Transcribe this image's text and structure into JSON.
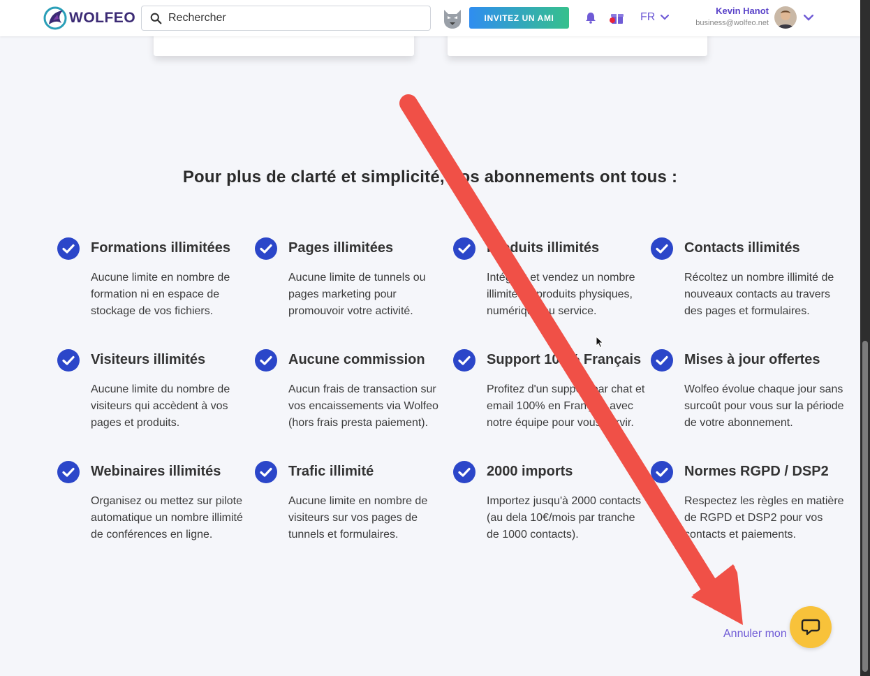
{
  "header": {
    "brand": "WOLFEO",
    "search_placeholder": "Rechercher",
    "invite_label": "INVITEZ UN AMI",
    "language": "FR",
    "user_name": "Kevin Hanot",
    "user_email": "business@wolfeo.net"
  },
  "colors": {
    "accent": "#6f5bd6",
    "check": "#2b46c9",
    "chat": "#f8c23a",
    "arrow": "#f05047"
  },
  "section": {
    "title": "Pour plus de clarté et simplicité, nos abonnements ont tous :"
  },
  "features": [
    {
      "title": "Formations illimitées",
      "desc": "Aucune limite en nombre de formation ni en espace de stockage de vos fichiers."
    },
    {
      "title": "Pages illimitées",
      "desc": "Aucune limite de tunnels ou pages marketing pour promouvoir votre activité."
    },
    {
      "title": "Produits illimités",
      "desc": "Intégrez et vendez un nombre illimité de produits physiques, numérique ou service."
    },
    {
      "title": "Contacts illimités",
      "desc": "Récoltez un nombre illimité de nouveaux contacts au travers des pages et formulaires."
    },
    {
      "title": "Visiteurs illimités",
      "desc": "Aucune limite du nombre de visiteurs qui accèdent à vos pages et produits."
    },
    {
      "title": "Aucune commission",
      "desc": "Aucun frais de transaction sur vos encaissements via Wolfeo (hors frais presta paiement)."
    },
    {
      "title": "Support 100% Français",
      "desc": "Profitez d'un support par chat et email 100% en Français avec notre équipe pour vous servir."
    },
    {
      "title": "Mises à jour offertes",
      "desc": "Wolfeo évolue chaque jour sans surcoût pour vous sur la période de votre abonnement."
    },
    {
      "title": "Webinaires illimités",
      "desc": "Organisez ou mettez sur pilote automatique un nombre illimité de conférences en ligne."
    },
    {
      "title": "Trafic illimité",
      "desc": "Aucune limite en nombre de visiteurs sur vos pages de tunnels et formulaires."
    },
    {
      "title": "2000 imports",
      "desc": "Importez jusqu'à 2000 contacts (au dela 10€/mois par tranche de 1000 contacts)."
    },
    {
      "title": "Normes RGPD / DSP2",
      "desc": "Respectez les règles en matière de RGPD et DSP2 pour vos contacts et paiements."
    }
  ],
  "footer": {
    "cancel_link": "Annuler mon"
  }
}
